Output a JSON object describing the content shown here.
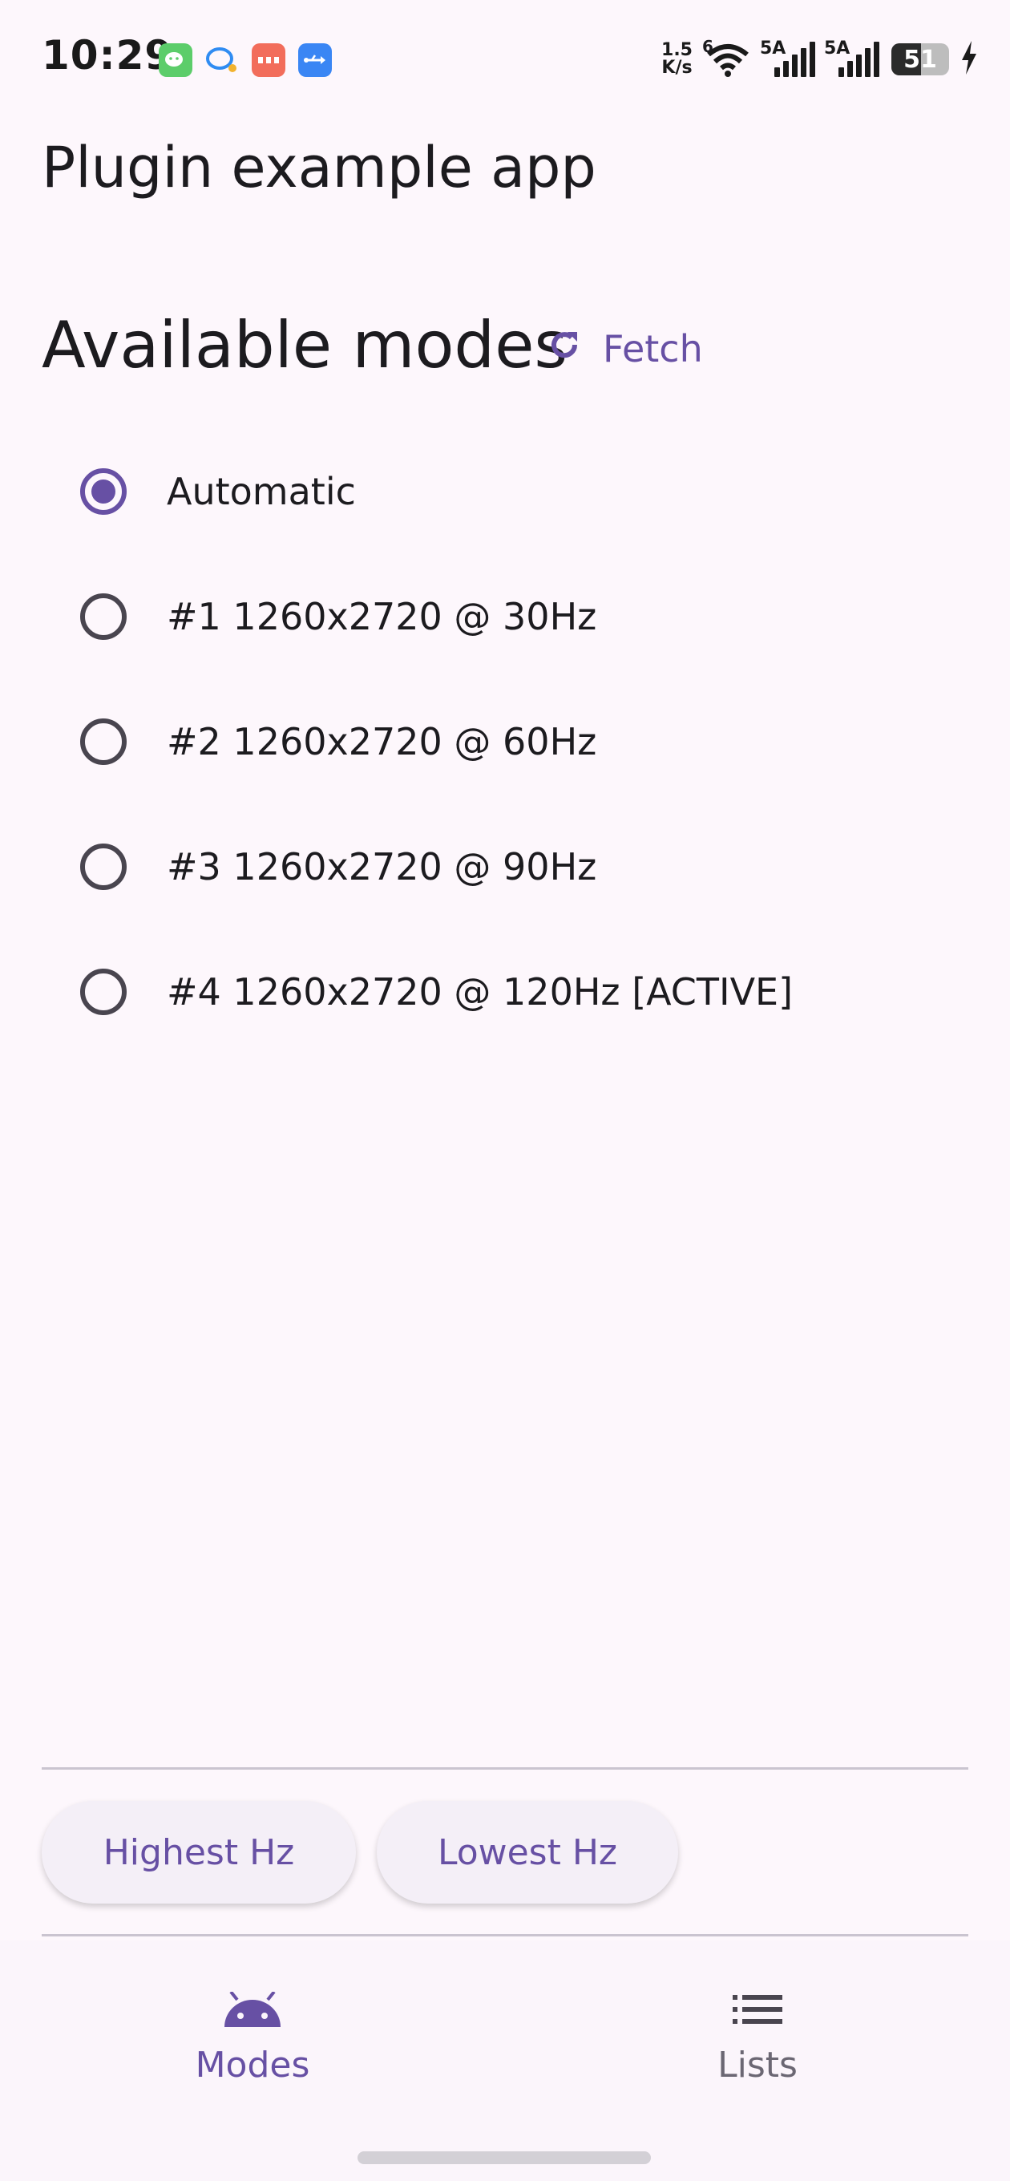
{
  "status_bar": {
    "time": "10:29",
    "net_speed_value": "1.5",
    "net_speed_unit": "K/s",
    "wifi_tag": "6",
    "sim1_tag": "5A",
    "sim2_tag": "5A",
    "battery_level": "51",
    "battery_fraction": 0.51,
    "notification_icons": [
      "wechat-icon",
      "messages-icon",
      "xiaohongshu-icon",
      "usb-icon"
    ]
  },
  "app_bar": {
    "title": "Plugin example app"
  },
  "modes_section": {
    "title": "Available modes",
    "fetch_label": "Fetch"
  },
  "modes": [
    {
      "label": "Automatic",
      "selected": true
    },
    {
      "label": "#1 1260x2720 @ 30Hz",
      "selected": false
    },
    {
      "label": "#2 1260x2720 @ 60Hz",
      "selected": false
    },
    {
      "label": "#3 1260x2720 @ 90Hz",
      "selected": false
    },
    {
      "label": "#4 1260x2720 @ 120Hz [ACTIVE]",
      "selected": false
    }
  ],
  "actions": {
    "highest_label": "Highest Hz",
    "lowest_label": "Lowest Hz"
  },
  "bottom_nav": {
    "items": [
      {
        "label": "Modes",
        "icon": "android-icon",
        "active": true
      },
      {
        "label": "Lists",
        "icon": "list-icon",
        "active": false
      }
    ]
  },
  "colors": {
    "accent": "#6750a4",
    "background": "#fdf7fc",
    "inactive": "#49454f"
  }
}
